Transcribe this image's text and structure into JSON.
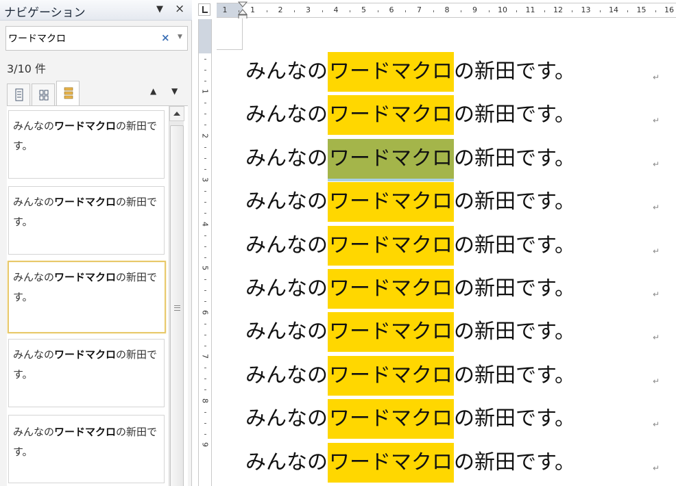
{
  "nav": {
    "title": "ナビゲーション",
    "menu_glyph": "▼",
    "close_glyph": "×",
    "search_value": "ワードマクロ",
    "clear_glyph": "×",
    "dropdown_glyph": "▼",
    "result_count": "3/10 件",
    "prev_glyph": "▲",
    "next_glyph": "▼",
    "results": [
      {
        "before": "みんなの",
        "match": "ワードマクロ",
        "after": "の新田です。"
      },
      {
        "before": "みんなの",
        "match": "ワードマクロ",
        "after": "の新田です。"
      },
      {
        "before": "みんなの",
        "match": "ワードマクロ",
        "after": "の新田です。"
      },
      {
        "before": "みんなの",
        "match": "ワードマクロ",
        "after": "の新田です。"
      },
      {
        "before": "みんなの",
        "match": "ワードマクロ",
        "after": "の新田です。"
      }
    ]
  },
  "ruler": {
    "h_numbers": [
      "1",
      "1",
      "2",
      "3",
      "4",
      "5",
      "6",
      "7",
      "8",
      "9",
      "10",
      "11",
      "12",
      "13",
      "14",
      "15",
      "16"
    ],
    "v_numbers": [
      "1",
      "2",
      "3",
      "4",
      "5",
      "6",
      "7",
      "8",
      "9"
    ]
  },
  "document": {
    "lines": [
      {
        "before": "みんなの",
        "match": "ワードマクロ",
        "after": "の新田です。"
      },
      {
        "before": "みんなの",
        "match": "ワードマクロ",
        "after": "の新田です。"
      },
      {
        "before": "みんなの",
        "match": "ワードマクロ",
        "after": "の新田です。"
      },
      {
        "before": "みんなの",
        "match": "ワードマクロ",
        "after": "の新田です。"
      },
      {
        "before": "みんなの",
        "match": "ワードマクロ",
        "after": "の新田です。"
      },
      {
        "before": "みんなの",
        "match": "ワードマクロ",
        "after": "の新田です。"
      },
      {
        "before": "みんなの",
        "match": "ワードマクロ",
        "after": "の新田です。"
      },
      {
        "before": "みんなの",
        "match": "ワードマクロ",
        "after": "の新田です。"
      },
      {
        "before": "みんなの",
        "match": "ワードマクロ",
        "after": "の新田です。"
      },
      {
        "before": "みんなの",
        "match": "ワードマクロ",
        "after": "の新田です。"
      }
    ],
    "paragraph_mark": "↵",
    "current_match_index": 3,
    "colors": {
      "highlight": "#ffd700",
      "current_highlight": "#a4b54a",
      "selected_result_border": "#e8c96b"
    }
  }
}
